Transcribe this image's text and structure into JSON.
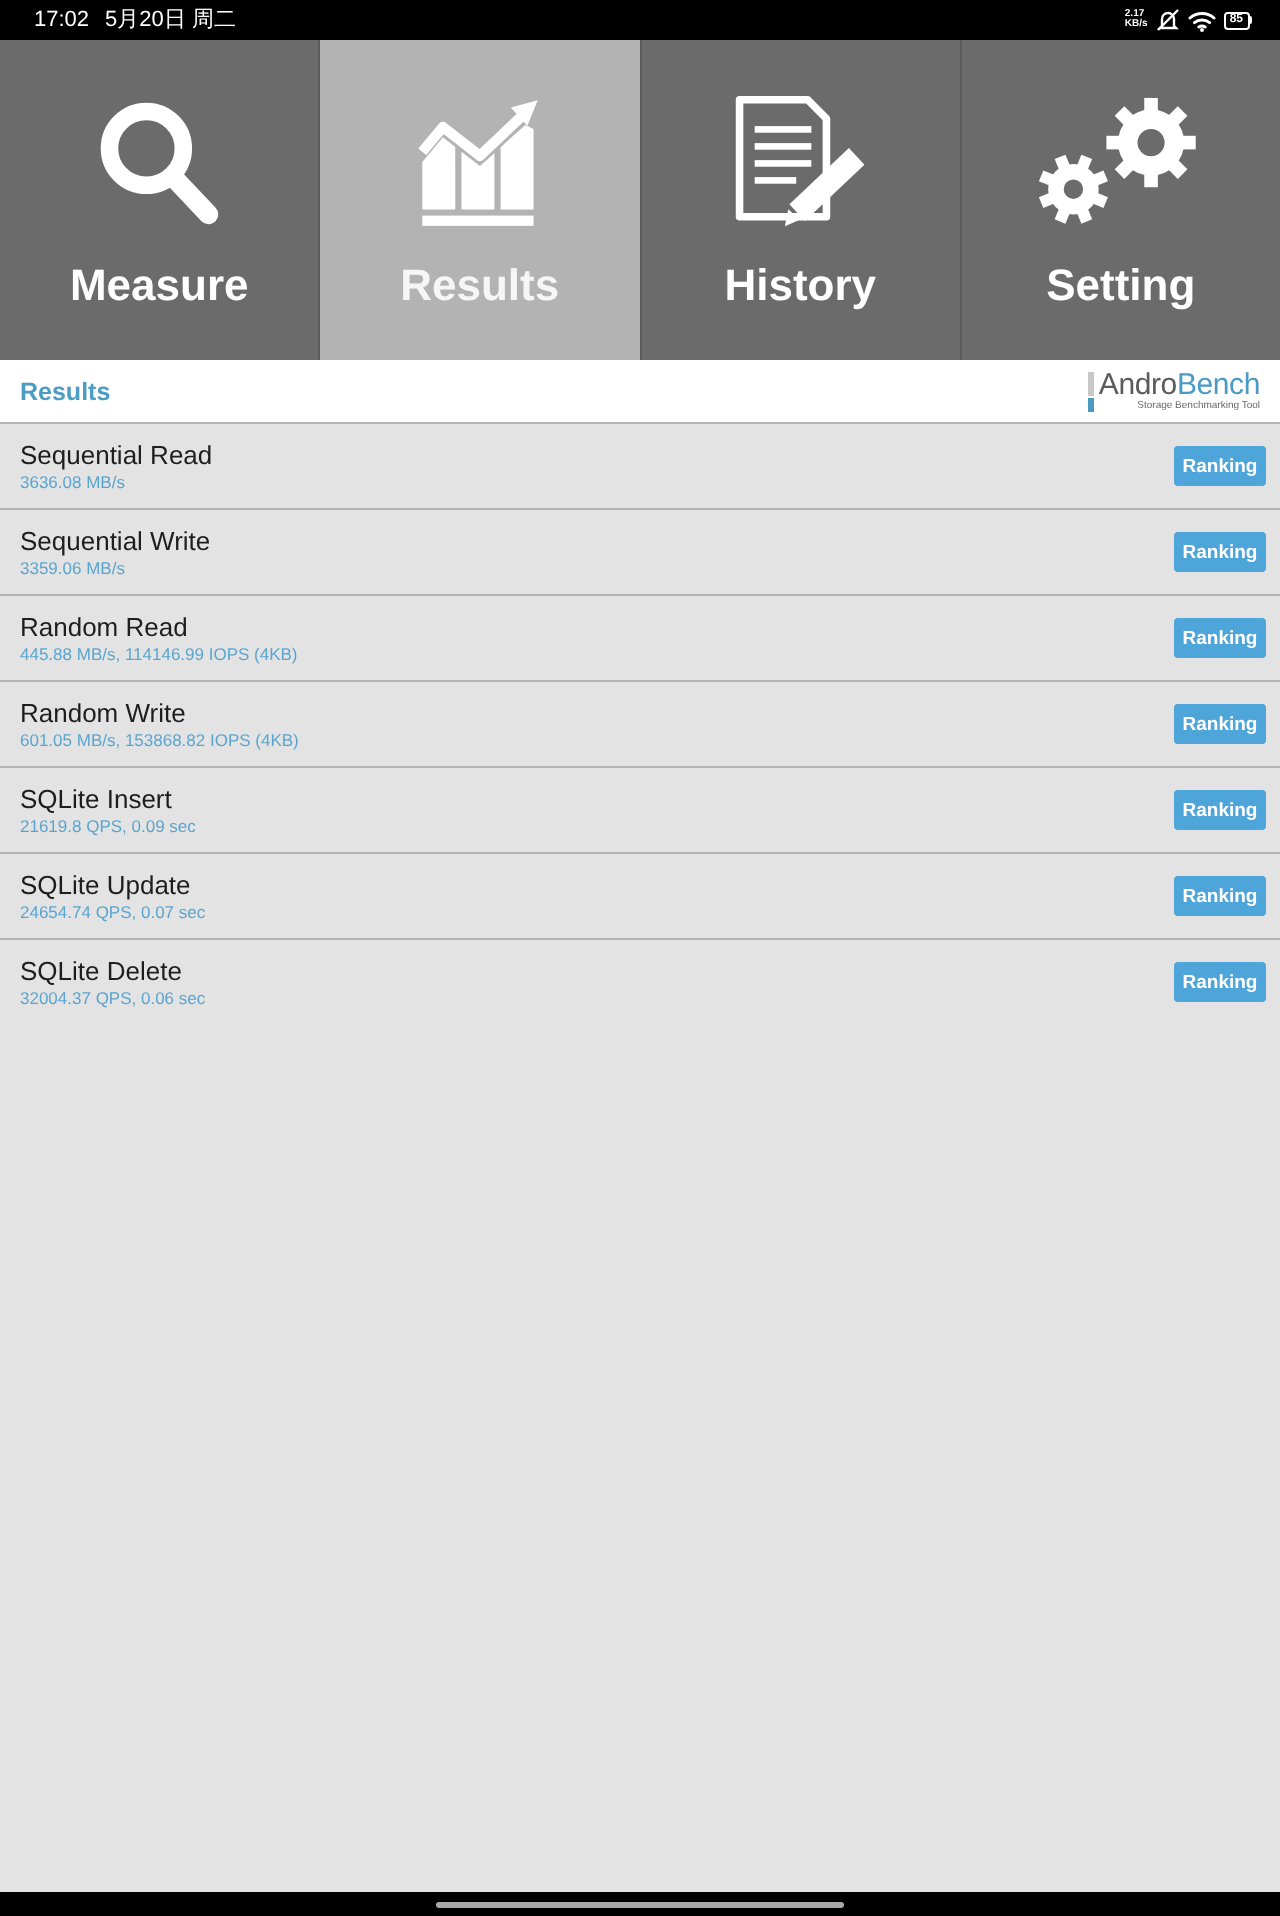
{
  "status_bar": {
    "time": "17:02",
    "date": "5月20日 周二",
    "network_speed": {
      "value": "2.17",
      "unit": "KB/s"
    },
    "battery": "85"
  },
  "tabs": [
    {
      "label": "Measure",
      "selected": false
    },
    {
      "label": "Results",
      "selected": true
    },
    {
      "label": "History",
      "selected": false
    },
    {
      "label": "Setting",
      "selected": false
    }
  ],
  "header": {
    "title": "Results",
    "logo": {
      "wordmark": [
        "Andro",
        "Bench"
      ],
      "tagline": "Storage Benchmarking Tool"
    }
  },
  "results": [
    {
      "name": "Sequential Read",
      "value": "3636.08 MB/s",
      "button": "Ranking"
    },
    {
      "name": "Sequential Write",
      "value": "3359.06 MB/s",
      "button": "Ranking"
    },
    {
      "name": "Random Read",
      "value": "445.88 MB/s, 114146.99 IOPS (4KB)",
      "button": "Ranking"
    },
    {
      "name": "Random Write",
      "value": "601.05 MB/s, 153868.82 IOPS (4KB)",
      "button": "Ranking"
    },
    {
      "name": "SQLite Insert",
      "value": "21619.8 QPS, 0.09 sec",
      "button": "Ranking"
    },
    {
      "name": "SQLite Update",
      "value": "24654.74 QPS, 0.07 sec",
      "button": "Ranking"
    },
    {
      "name": "SQLite Delete",
      "value": "32004.37 QPS, 0.06 sec",
      "button": "Ranking"
    }
  ]
}
